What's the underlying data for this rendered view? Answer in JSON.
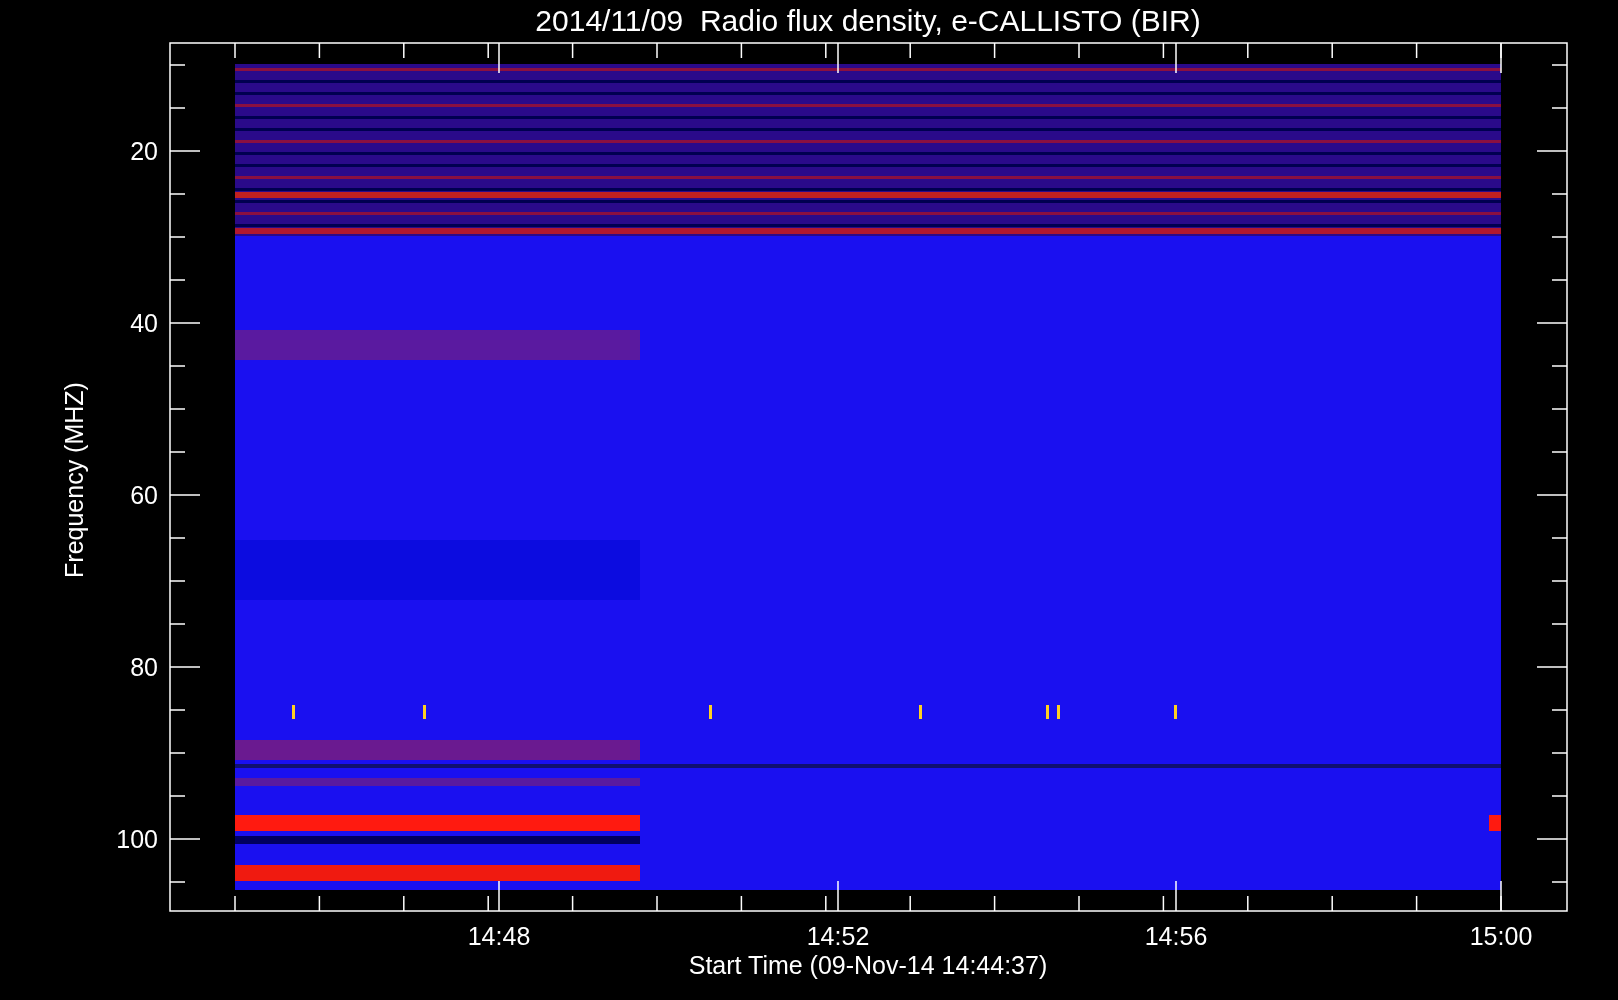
{
  "title": "2014/11/09  Radio flux density, e-CALLISTO (BIR)",
  "y_axis": {
    "label": "Frequency (MHZ)",
    "ticks": [
      "20",
      "40",
      "60",
      "80",
      "100"
    ]
  },
  "x_axis": {
    "label": "Start Time (09-Nov-14 14:44:37)",
    "ticks": [
      "14:48",
      "14:52",
      "14:56",
      "15:00"
    ]
  }
}
